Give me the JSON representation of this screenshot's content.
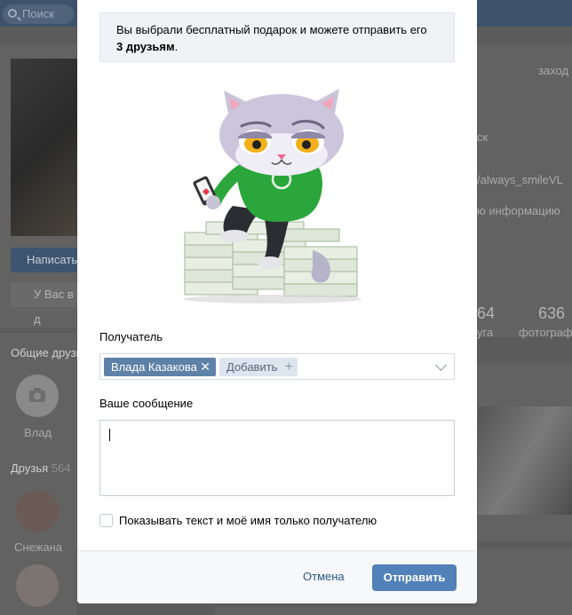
{
  "background": {
    "search_placeholder": "Поиск",
    "write_button": "Написать",
    "you_have_button": "У Вас в д",
    "common_friends": "Общие друзь",
    "friend_vlad": "Влад",
    "friends_label": "Друзья",
    "friends_count": "564",
    "friend_snezhana": "Снежана",
    "right_zahod": "заход",
    "right_sk": "ск",
    "right_link": "/always_smileVL",
    "right_info": "ю информацию",
    "right_stat_1": "64",
    "right_stat_1_label": "уга",
    "right_stat_2": "636",
    "right_stat_2_label": "фотограф"
  },
  "modal": {
    "info_text": "Вы выбрали бесплатный подарок и можете отправить его",
    "info_bold": "3 друзьям",
    "info_tail": ".",
    "recipient_label": "Получатель",
    "recipient_tag": "Влада Казакова",
    "add_label": "Добавить",
    "message_label": "Ваше сообщение",
    "privacy_checkbox_label": "Показывать текст и моё имя только получателю",
    "cancel_label": "Отмена",
    "send_label": "Отправить"
  },
  "colors": {
    "accent": "#5181b8",
    "tag_bg": "#5e81a8",
    "link": "#2a5885"
  }
}
